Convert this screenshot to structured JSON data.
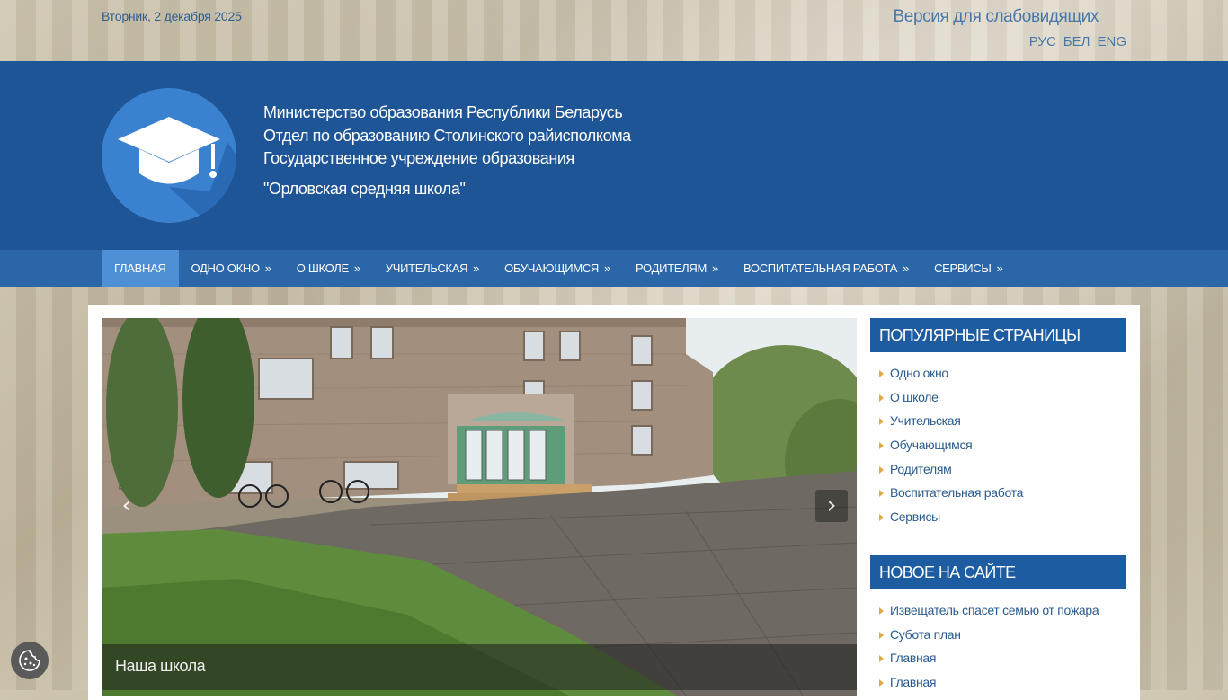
{
  "top": {
    "date": "Вторник, 2 декабря 2025",
    "low_vision": "Версия для слабовидящих",
    "languages": [
      "РУС",
      "БЕЛ",
      "ENG"
    ]
  },
  "header": {
    "lines": [
      "Министерство образования Республики Беларусь",
      "Отдел по образованию Столинского райисполкома",
      "Государственное учреждение образования"
    ],
    "school": "\"Орловская средняя школа\""
  },
  "nav": {
    "items": [
      {
        "label": "ГЛАВНАЯ",
        "arrow": ""
      },
      {
        "label": "ОДНО ОКНО",
        "arrow": "»"
      },
      {
        "label": "О ШКОЛЕ",
        "arrow": "»"
      },
      {
        "label": "УЧИТЕЛЬСКАЯ",
        "arrow": "»"
      },
      {
        "label": "ОБУЧАЮЩИМСЯ",
        "arrow": "»"
      },
      {
        "label": "РОДИТЕЛЯМ",
        "arrow": "»"
      },
      {
        "label": "ВОСПИТАТЕЛЬНАЯ РАБОТА",
        "arrow": "»"
      },
      {
        "label": "СЕРВИСЫ",
        "arrow": "»"
      }
    ]
  },
  "slider": {
    "caption": "Наша школа",
    "prev": "‹",
    "next": "›"
  },
  "sidebar": {
    "popular": {
      "title": "ПОПУЛЯРНЫЕ СТРАНИЦЫ",
      "items": [
        "Одно окно",
        "О школе",
        "Учительская",
        "Обучающимся",
        "Родителям",
        "Воспитательная работа",
        "Сервисы"
      ]
    },
    "new": {
      "title": "НОВОЕ НА САЙТЕ",
      "items": [
        "Извещатель спасет семью от пожара",
        "Субота план",
        "Главная",
        "Главная"
      ]
    }
  },
  "icons": {
    "logo": "graduation-cap-icon",
    "cookie": "cookie-icon"
  },
  "colors": {
    "header": "#1e5597",
    "nav": "#2b66a8",
    "nav_active": "#4f8fd6",
    "sidebar_head": "#1e5ca2",
    "link": "#2a5b8f",
    "bullet": "#e0a847"
  }
}
